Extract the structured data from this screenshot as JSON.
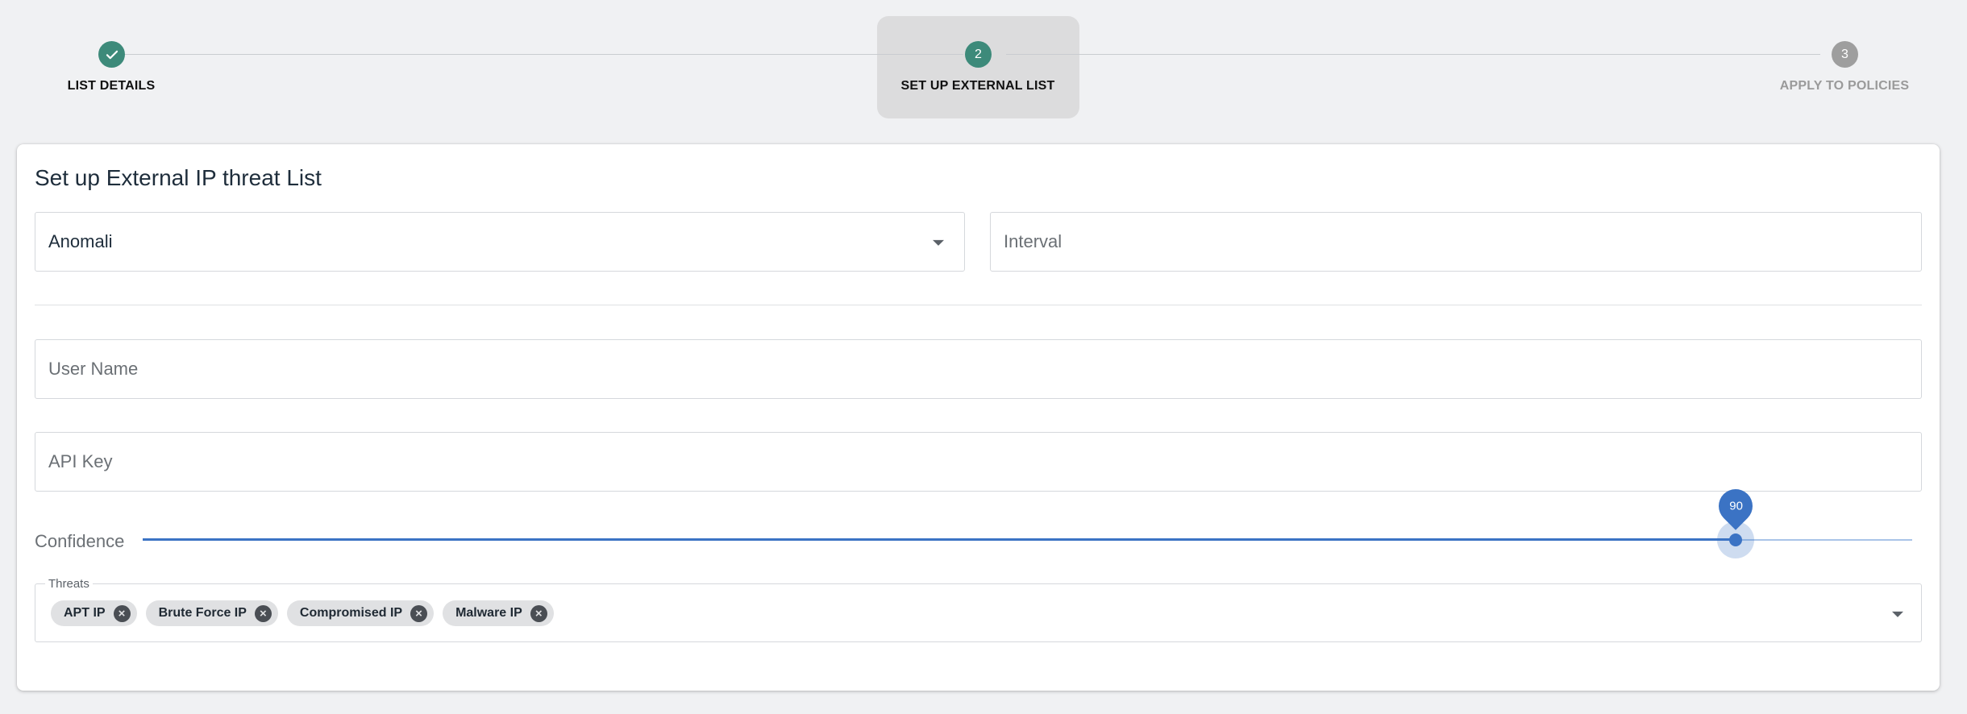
{
  "stepper": {
    "steps": [
      {
        "number": "1",
        "label": "LIST DETAILS",
        "status": "completed",
        "icon": "check-icon"
      },
      {
        "number": "2",
        "label": "SET UP EXTERNAL LIST",
        "status": "active"
      },
      {
        "number": "3",
        "label": "APPLY TO POLICIES",
        "status": "pending"
      }
    ]
  },
  "form": {
    "title": "Set up External IP threat List",
    "provider": {
      "value": "Anomali"
    },
    "interval": {
      "placeholder": "Interval"
    },
    "username": {
      "placeholder": "User Name"
    },
    "api_key": {
      "placeholder": "API Key"
    },
    "confidence": {
      "label": "Confidence",
      "value": "90",
      "fraction": 0.9
    },
    "threats": {
      "label": "Threats",
      "chips": [
        "APT IP",
        "Brute Force IP",
        "Compromised IP",
        "Malware IP"
      ]
    }
  },
  "colors": {
    "primary_green": "#3d8a7a",
    "slider_blue": "#3b73c4",
    "page_bg": "#f0f1f3"
  }
}
